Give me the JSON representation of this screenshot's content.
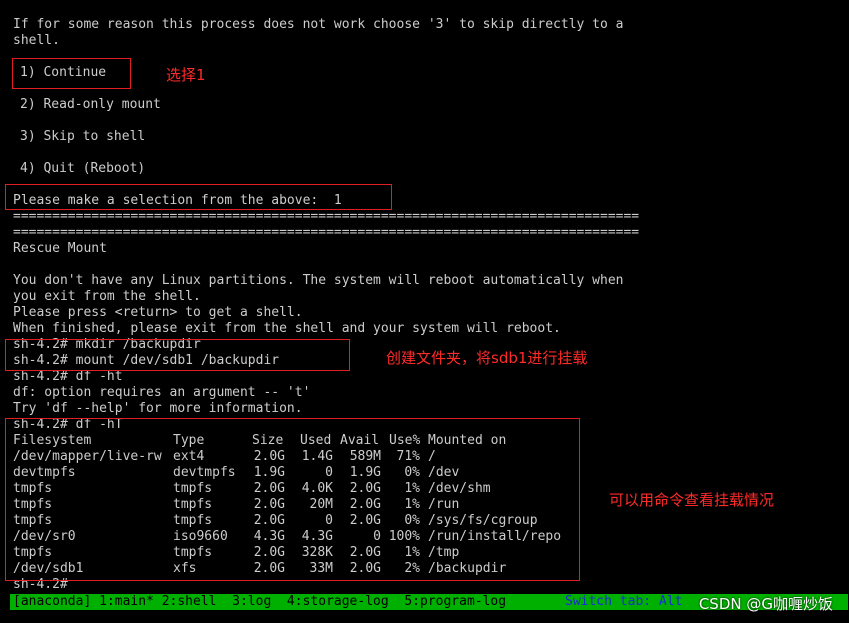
{
  "terminal": {
    "intro_line1": "If for some reason this process does not work choose '3' to skip directly to a",
    "intro_line2": "shell.",
    "options": [
      {
        "label": "1) Continue"
      },
      {
        "label": "2) Read-only mount"
      },
      {
        "label": "3) Skip to shell"
      },
      {
        "label": "4) Quit (Reboot)"
      }
    ],
    "selection_prompt": "Please make a selection from the above:  1",
    "separator": "================================================================================",
    "rescue_title": "Rescue Mount",
    "msg1": "You don't have any Linux partitions. The system will reboot automatically when",
    "msg2": "you exit from the shell.",
    "msg3": "Please press <return> to get a shell.",
    "msg4": "When finished, please exit from the shell and your system will reboot.",
    "cmd_mkdir": "sh-4.2# mkdir /backupdir",
    "cmd_mount": "sh-4.2# mount /dev/sdb1 /backupdir",
    "cmd_df_bad": "sh-4.2# df -ht",
    "df_err1": "df: option requires an argument -- 't'",
    "df_err2": "Try 'df --help' for more information.",
    "cmd_df": "sh-4.2# df -hT",
    "prompt_end": "sh-4.2#"
  },
  "df_table": {
    "headers": [
      "Filesystem",
      "Type",
      "Size",
      "Used",
      "Avail",
      "Use%",
      "Mounted on"
    ],
    "rows": [
      [
        "/dev/mapper/live-rw",
        "ext4",
        "2.0G",
        "1.4G",
        "589M",
        "71%",
        "/"
      ],
      [
        "devtmpfs",
        "devtmpfs",
        "1.9G",
        "0",
        "1.9G",
        "0%",
        "/dev"
      ],
      [
        "tmpfs",
        "tmpfs",
        "2.0G",
        "4.0K",
        "2.0G",
        "1%",
        "/dev/shm"
      ],
      [
        "tmpfs",
        "tmpfs",
        "2.0G",
        "20M",
        "2.0G",
        "1%",
        "/run"
      ],
      [
        "tmpfs",
        "tmpfs",
        "2.0G",
        "0",
        "2.0G",
        "0%",
        "/sys/fs/cgroup"
      ],
      [
        "/dev/sr0",
        "iso9660",
        "4.3G",
        "4.3G",
        "0",
        "100%",
        "/run/install/repo"
      ],
      [
        "tmpfs",
        "tmpfs",
        "2.0G",
        "328K",
        "2.0G",
        "1%",
        "/tmp"
      ],
      [
        "/dev/sdb1",
        "xfs",
        "2.0G",
        "33M",
        "2.0G",
        "2%",
        "/backupdir"
      ]
    ]
  },
  "annotations": {
    "note_select": "选择1",
    "note_mount": "创建文件夹，将sdb1进行挂载",
    "note_df": "可以用命令查看挂载情况"
  },
  "statusbar": {
    "left": "[anaconda] 1:main* 2:shell  3:log  4:storage-log  5:program-log",
    "right": "Switch tab: Alt"
  },
  "watermark": "CSDN @G咖喱炒饭",
  "colors": {
    "background": "#000000",
    "text": "#cccccc",
    "highlight_box": "#e02020",
    "annotation": "#ff2a2a",
    "statusbar": "#00b000",
    "statusbar_tab": "#1a2bd8"
  }
}
